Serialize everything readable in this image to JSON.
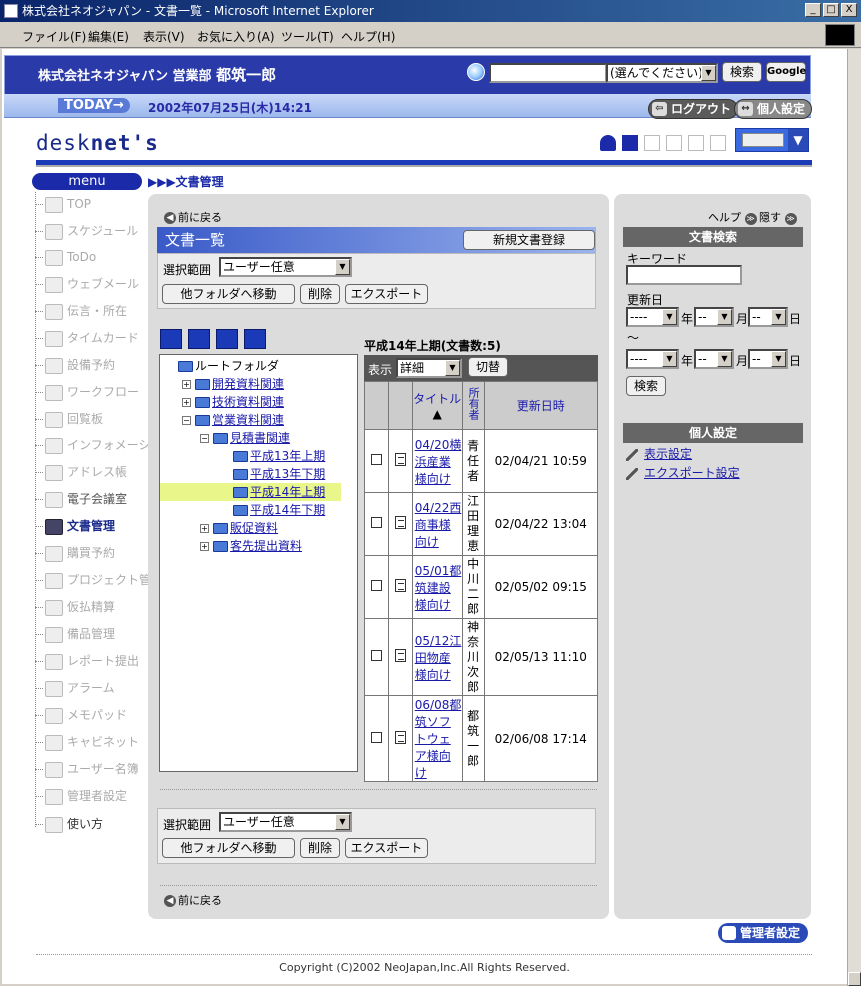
{
  "window": {
    "title": "株式会社ネオジャパン - 文書一覧 - Microsoft Internet Explorer",
    "controls": [
      "_",
      "□",
      "X"
    ]
  },
  "menubar": [
    "ファイル(F)",
    "編集(E)",
    "表示(V)",
    "お気に入り(A)",
    "ツール(T)",
    "ヘルプ(H)"
  ],
  "header": {
    "company": "株式会社ネオジャパン",
    "dept": "営業部",
    "user": "都筑一郎",
    "search_select": "(選んでください)",
    "search_btn": "検索",
    "google_btn": "Google"
  },
  "today": {
    "label": "TODAY→",
    "date": "2002年07月25日(木)14:21",
    "logout": "ログアウト",
    "personal": "個人設定"
  },
  "logo": {
    "a": "desk",
    "b": "net's"
  },
  "nav": {
    "menu_label": "menu",
    "breadcrumb": "▶▶▶文書管理",
    "items": [
      "TOP",
      "スケジュール",
      "ToDo",
      "ウェブメール",
      "伝言・所在",
      "タイムカード",
      "設備予約",
      "ワークフロー",
      "回覧板",
      "インフォメーション",
      "アドレス帳",
      "電子会議室",
      "文書管理",
      "購買予約",
      "プロジェクト管理",
      "仮払精算",
      "備品管理",
      "レポート提出",
      "アラーム",
      "メモパッド",
      "キャビネット",
      "ユーザー名簿",
      "管理者設定",
      "使い方"
    ]
  },
  "main": {
    "back": "前に戻る",
    "doc_list_title": "文書一覧",
    "new_doc_btn": "新規文書登録",
    "range_label": "選択範囲",
    "range_value": "ユーザー任意",
    "move_btn": "他フォルダへ移動",
    "delete_btn": "削除",
    "export_btn": "エクスポート"
  },
  "tree": {
    "root": "ルートフォルダ",
    "nodes": [
      {
        "label": "開発資料関連",
        "pm": "+"
      },
      {
        "label": "技術資料関連",
        "pm": "+"
      },
      {
        "label": "営業資料関連",
        "pm": "−"
      },
      {
        "label": "見積書関連",
        "pm": "−"
      },
      {
        "label": "平成13年上期"
      },
      {
        "label": "平成13年下期"
      },
      {
        "label": "平成14年上期"
      },
      {
        "label": "平成14年下期"
      },
      {
        "label": "販促資料",
        "pm": "+"
      },
      {
        "label": "客先提出資料",
        "pm": "+"
      }
    ]
  },
  "table": {
    "title": "平成14年上期(文書数:5)",
    "view_label": "表示",
    "view_value": "詳細",
    "switch_btn": "切替",
    "col_title": "タイトル",
    "col_owner": "所有者",
    "col_updated": "更新日時",
    "sort_mark": "▲",
    "rows": [
      {
        "title": "04/20横浜産業様向け",
        "owner": "青任者",
        "updated": "02/04/21 10:59"
      },
      {
        "title": "04/22西商事様向け",
        "owner": "江田理恵",
        "updated": "02/04/22 13:04"
      },
      {
        "title": "05/01都筑建設様向け",
        "owner": "中川二郎",
        "updated": "02/05/02 09:15"
      },
      {
        "title": "05/12江田物産様向け",
        "owner": "神奈川次郎",
        "updated": "02/05/13 11:10"
      },
      {
        "title": "06/08都筑ソフトウェア様向け",
        "owner": "都筑一郎",
        "updated": "02/06/08 17:14"
      }
    ]
  },
  "right": {
    "help": "ヘルプ",
    "hide": "隠す",
    "search_head": "文書検索",
    "keyword": "キーワード",
    "updated": "更新日",
    "dash": "----",
    "dd": "--",
    "year": "年",
    "month": "月",
    "day": "日",
    "tilde": "〜",
    "search_btn": "検索",
    "personal_head": "個人設定",
    "display_settings": "表示設定",
    "export_settings": "エクスポート設定"
  },
  "admin_btn": "管理者設定",
  "copyright": "Copyright (C)2002 NeoJapan,Inc.All Rights Reserved."
}
